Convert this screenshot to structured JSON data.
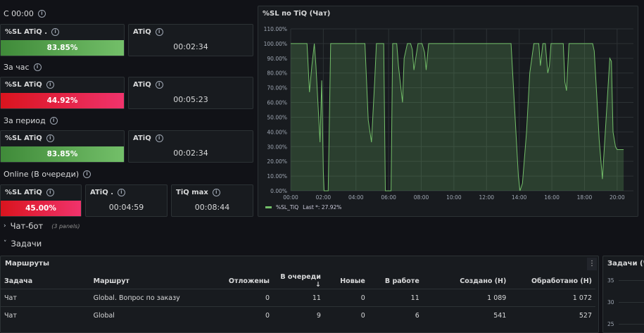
{
  "sections": {
    "since": "С 00:00",
    "hour": "За час",
    "period": "За период",
    "online": "Online (В очереди)"
  },
  "stats": {
    "s1": {
      "sl_title": "%SL ATiQ .",
      "sl_value": "83.85%",
      "sl_color": "#56a64b",
      "atiq_title": "ATiQ",
      "atiq_value": "00:02:34"
    },
    "s2": {
      "sl_title": "%SL ATiQ",
      "sl_value": "44.92%",
      "sl_color": "#e0226e",
      "atiq_title": "ATiQ",
      "atiq_value": "00:05:23"
    },
    "s3": {
      "sl_title": "%SL ATiQ",
      "sl_value": "83.85%",
      "sl_color": "#56a64b",
      "atiq_title": "ATiQ",
      "atiq_value": "00:02:34"
    },
    "s4": {
      "sl_title": "%SL ATiQ",
      "sl_value": "45.00%",
      "sl_color": "#e0226e",
      "atiq_title": "ATiQ .",
      "atiq_value": "00:04:59",
      "tiq_title": "TiQ max",
      "tiq_value": "00:08:44"
    }
  },
  "chart": {
    "panel_title": "%SL по TiQ (Чат)",
    "legend_name": "%SL_TiQ",
    "legend_last": "Last *: 27.92%"
  },
  "chart_data": {
    "type": "area",
    "title": "%SL по TiQ (Чат)",
    "x_ticks": [
      "00:00",
      "02:00",
      "04:00",
      "06:00",
      "08:00",
      "10:00",
      "12:00",
      "14:00",
      "16:00",
      "18:00",
      "20:00"
    ],
    "y_ticks": [
      "0.00%",
      "10.00%",
      "20.00%",
      "30.00%",
      "40.00%",
      "50.00%",
      "60.00%",
      "70.00%",
      "80.00%",
      "90.00%",
      "100.00%",
      "110.00%"
    ],
    "ylim": [
      0,
      110
    ],
    "xlim": [
      0,
      21
    ],
    "series": [
      {
        "name": "%SL_TiQ",
        "color": "#73bf69",
        "x": [
          0,
          0.5,
          1,
          1.05,
          1.15,
          1.3,
          1.45,
          1.55,
          1.8,
          1.9,
          2.0,
          2.05,
          2.3,
          2.45,
          2.6,
          2.7,
          2.85,
          3.0,
          4.3,
          4.55,
          4.75,
          4.95,
          5.15,
          5.25,
          5.7,
          5.8,
          5.95,
          6.15,
          6.25,
          6.35,
          6.5,
          6.6,
          6.85,
          6.95,
          7.15,
          7.35,
          7.45,
          7.55,
          7.8,
          8.05,
          8.2,
          8.3,
          8.45,
          13.4,
          13.5,
          13.7,
          13.85,
          13.95,
          14.05,
          14.2,
          14.45,
          14.65,
          14.9,
          15.2,
          15.3,
          15.45,
          15.6,
          15.75,
          15.85,
          15.95,
          16.1,
          16.3,
          16.6,
          16.7,
          16.8,
          16.9,
          17.05,
          18.0,
          18.3,
          18.4,
          18.5,
          18.6,
          18.8,
          18.9,
          19.1,
          19.55,
          19.65,
          19.75,
          19.9,
          20.0,
          20.1,
          20.2,
          20.3,
          20.4
        ],
        "y": [
          100,
          100,
          100,
          90,
          67,
          85,
          100,
          85,
          33,
          75,
          13,
          0,
          0,
          100,
          100,
          100,
          100,
          100,
          100,
          100,
          48,
          33,
          75,
          100,
          100,
          0,
          0,
          0,
          100,
          100,
          100,
          85,
          60,
          90,
          100,
          100,
          96,
          82,
          100,
          100,
          94,
          82,
          100,
          100,
          100,
          60,
          30,
          10,
          0,
          5,
          40,
          80,
          100,
          100,
          85,
          100,
          100,
          80,
          85,
          100,
          100,
          100,
          100,
          100,
          74,
          68,
          100,
          100,
          100,
          100,
          100,
          95,
          55,
          35,
          8,
          90,
          88,
          40,
          30,
          28,
          28,
          28,
          28,
          28
        ]
      }
    ]
  },
  "collapsed_rows": [
    {
      "label": "Чат-бот",
      "sub": "(3 panels)"
    },
    {
      "label": "Задачи"
    }
  ],
  "table_panel": {
    "title": "Маршруты",
    "menu_icon": "⋮",
    "columns": [
      "Задача",
      "Маршрут",
      "Отложены",
      "В очереди",
      "Новые",
      "В работе",
      "Создано (Н)",
      "Обработано (Н)"
    ],
    "rows": [
      [
        "Чат",
        "Global. Вопрос по заказу",
        "0",
        "11",
        "0",
        "11",
        "1 089",
        "1 072"
      ],
      [
        "Чат",
        "Global",
        "0",
        "9",
        "0",
        "6",
        "541",
        "527"
      ]
    ]
  },
  "tasks_panel": {
    "title": "Задачи (Чат",
    "y_ticks": [
      "35",
      "30",
      "25"
    ]
  }
}
